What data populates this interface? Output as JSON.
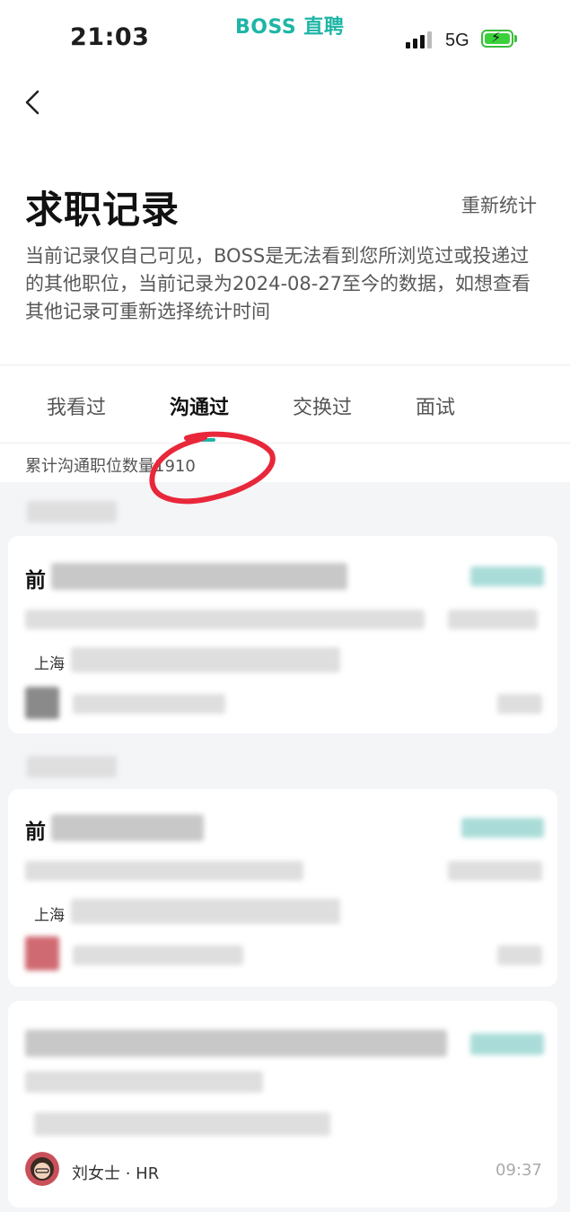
{
  "status_bar": {
    "time": "21:03",
    "app_brand": "BOSS 直聘",
    "network": "5G",
    "battery_color": "#3bd13b"
  },
  "header": {
    "back_icon": "chevron-left-icon",
    "title": "求职记录",
    "restat_label": "重新统计",
    "description": "当前记录仅自己可见，BOSS是无法看到您所浏览过或投递过的其他职位，当前记录为2024-08-27至今的数据，如想查看其他记录可重新选择统计时间"
  },
  "tabs": [
    {
      "label": "我看过",
      "active": false
    },
    {
      "label": "沟通过",
      "active": true
    },
    {
      "label": "交换过",
      "active": false
    },
    {
      "label": "面试",
      "active": false
    }
  ],
  "accent_color": "#1eb5a6",
  "summary": {
    "count_label": "累计沟通职位数量1910"
  },
  "cards": [
    {
      "title_prefix": "前",
      "location_prefix": "上海"
    },
    {
      "title_prefix": "前",
      "location_prefix": "上海"
    },
    {
      "hr_name": "刘女士 · HR",
      "time": "09:37"
    }
  ],
  "annotation": {
    "type": "red hand-drawn circle",
    "color": "#e8283a"
  }
}
